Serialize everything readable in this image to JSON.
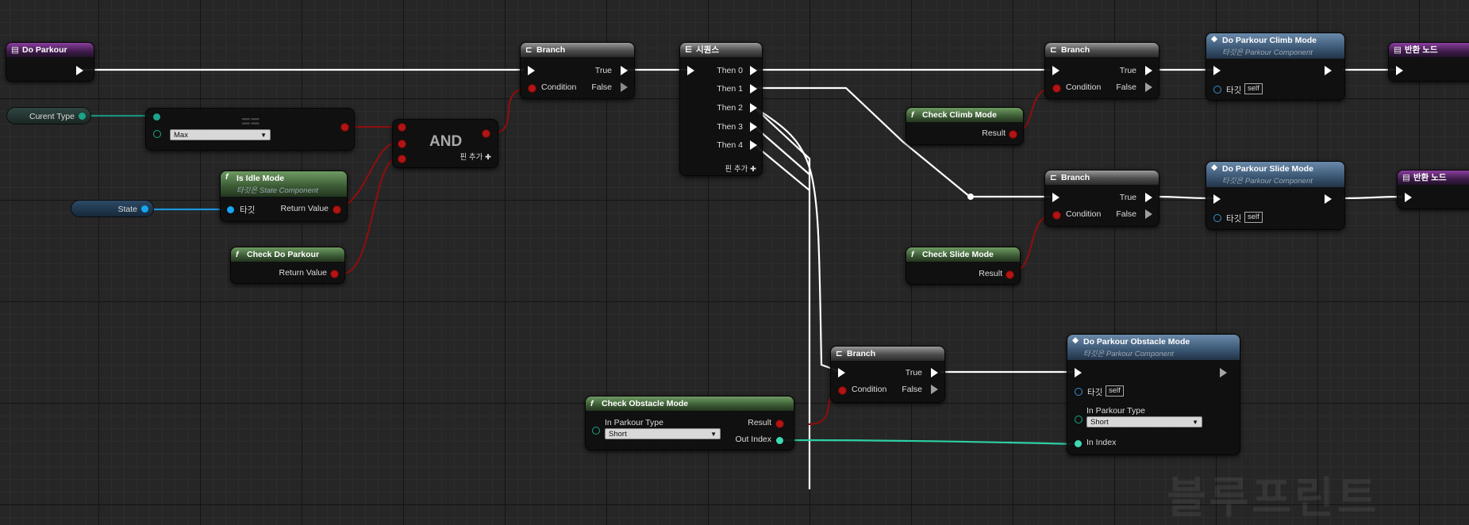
{
  "nodes": {
    "do_parkour": {
      "title": "Do Parkour"
    },
    "branch1": {
      "title": "Branch",
      "true": "True",
      "false": "False",
      "condition": "Condition"
    },
    "sequence": {
      "title": "시퀀스",
      "then0": "Then 0",
      "then1": "Then 1",
      "then2": "Then 2",
      "then3": "Then 3",
      "then4": "Then 4",
      "add_pin": "핀 추가"
    },
    "curent_type": {
      "label": "Curent Type"
    },
    "equals": {
      "title": "==",
      "dropdown": "Max"
    },
    "and": {
      "title": "AND",
      "add_pin": "핀 추가"
    },
    "is_idle": {
      "title": "Is Idle Mode",
      "subtitle": "타깃은 State Component",
      "target": "타깃",
      "return": "Return Value"
    },
    "state_var": {
      "label": "State"
    },
    "check_do_parkour": {
      "title": "Check Do Parkour",
      "return": "Return Value"
    },
    "branch2": {
      "title": "Branch",
      "true": "True",
      "false": "False",
      "condition": "Condition"
    },
    "climb_mode": {
      "title": "Do Parkour Climb Mode",
      "subtitle": "타깃은 Parkour Component",
      "target": "타깃",
      "self": "self"
    },
    "return1": {
      "title": "반환 노드"
    },
    "check_climb": {
      "title": "Check Climb Mode",
      "result": "Result"
    },
    "branch3": {
      "title": "Branch",
      "true": "True",
      "false": "False",
      "condition": "Condition"
    },
    "slide_mode": {
      "title": "Do Parkour Slide Mode",
      "subtitle": "타깃은 Parkour Component",
      "target": "타깃",
      "self": "self"
    },
    "return2": {
      "title": "반환 노드"
    },
    "check_slide": {
      "title": "Check Slide Mode",
      "result": "Result"
    },
    "branch4": {
      "title": "Branch",
      "true": "True",
      "false": "False",
      "condition": "Condition"
    },
    "obstacle_mode": {
      "title": "Do Parkour Obstacle Mode",
      "subtitle": "타깃은 Parkour Component",
      "target": "타깃",
      "self": "self",
      "in_type": "In Parkour Type",
      "in_type_value": "Short",
      "in_index": "In Index"
    },
    "check_obstacle": {
      "title": "Check Obstacle Mode",
      "in_type": "In Parkour Type",
      "in_type_value": "Short",
      "result": "Result",
      "out_index": "Out Index"
    }
  },
  "watermark": "블루프린트",
  "colors": {
    "exec": "#ffffff",
    "bool": "#b31414",
    "enum": "#1aa58a",
    "object": "#16a6f4",
    "int": "#3fd9b3"
  }
}
